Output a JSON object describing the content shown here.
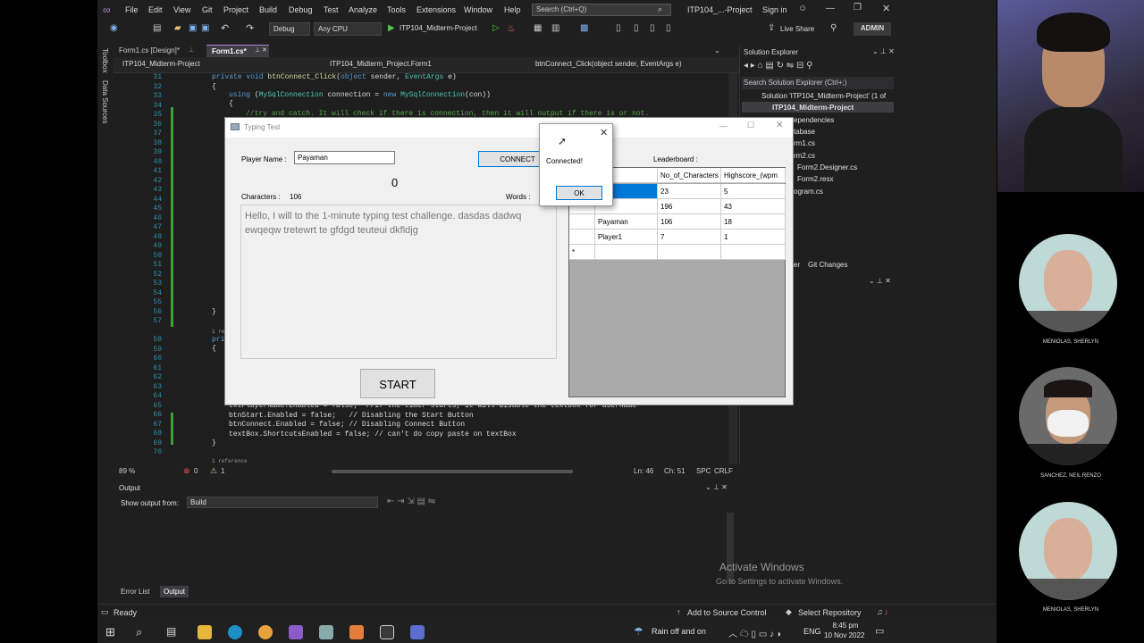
{
  "menubar": {
    "items": [
      "File",
      "Edit",
      "View",
      "Git",
      "Project",
      "Build",
      "Debug",
      "Test",
      "Analyze",
      "Tools",
      "Extensions",
      "Window",
      "Help"
    ],
    "search_placeholder": "Search (Ctrl+Q)",
    "solution_title": "ITP104_...-Project",
    "sign_in": "Sign in",
    "live_share": "Live Share",
    "admin_badge": "ADMIN"
  },
  "toolbar": {
    "config": "Debug",
    "platform": "Any CPU",
    "run_target": "ITP104_Midterm-Project"
  },
  "side_tabs": [
    "Toolbox",
    "Data Sources"
  ],
  "doc_tabs": [
    {
      "label": "Form1.cs [Design]*"
    },
    {
      "label": "Form1.cs*"
    }
  ],
  "navbar": {
    "project": "ITP104_Midterm-Project",
    "class": "ITP104_Midterm_Project.Form1",
    "member": "btnConnect_Click(object sender, EventArgs e)"
  },
  "editor": {
    "line_numbers": [
      "31",
      "32",
      "33",
      "34",
      "35",
      "36",
      "37",
      "38",
      "39",
      "40",
      "41",
      "42",
      "43",
      "44",
      "45",
      "46",
      "47",
      "48",
      "49",
      "50",
      "51",
      "52",
      "53",
      "54",
      "55",
      "56",
      "57",
      "",
      "58",
      "59",
      "60",
      "61",
      "62",
      "63",
      "64",
      "65",
      "66",
      "67",
      "68",
      "69",
      "70"
    ],
    "line_private": "private void btnConnect_Click(object sender, EventArgs e)",
    "line_open": "{",
    "line_using": "using (MySqlConnection connection = new MySqlConnection(con))",
    "line_open2": "{",
    "line_comment": "//try and catch. It will check if there is connection, then it will output if there is or not.",
    "line_close": "}",
    "line_ref": "1 reference",
    "line_pri": "pri",
    "line_open3": "{",
    "line_65": "txtPlayerName.Enabled = false;  //if the timer starts, it will disable the textbox for username",
    "line_66": "btnStart.Enabled = false;   // Disabling the Start Button",
    "line_67": "btnConnect.Enabled = false; // Disabling Connect Button",
    "line_68": "textBox.ShortcutsEnabled = false; // can't do copy paste on textBox",
    "line_69": "}",
    "line_ref2": "1 reference"
  },
  "editor_status": {
    "zoom": "89 %",
    "errors": "0",
    "warnings": "1",
    "line": "Ln: 46",
    "col": "Ch: 51",
    "spc": "SPC",
    "crlf": "CRLF"
  },
  "solution_explorer": {
    "title": "Solution Explorer",
    "search": "Search Solution Explorer (Ctrl+;)",
    "items": [
      "Solution 'ITP104_Midterm-Project' (1 of",
      "ITP104_Midterm-Project",
      "ependencies",
      "tabase",
      "rm1.cs",
      "rm2.cs",
      "Form2.Designer.cs",
      "Form2.resx",
      "ogram.cs"
    ],
    "bottom_tabs": [
      "er",
      "Git Changes"
    ]
  },
  "output": {
    "title": "Output",
    "show_from_label": "Show output from:",
    "show_from_value": "Build",
    "tabs": [
      "Error List",
      "Output"
    ]
  },
  "watermark": {
    "line1": "Activate Windows",
    "line2": "Go to Settings to activate Windows."
  },
  "statusbar": {
    "ready": "Ready",
    "source_control": "Add to Source Control",
    "repository": "Select Repository",
    "notifications": "2"
  },
  "taskbar": {
    "weather": "Rain off and on",
    "lang": "ENG",
    "time": "8:45 pm",
    "date": "10 Nov 2022"
  },
  "form": {
    "title": "Typing Test",
    "player_label": "Player Name :",
    "player_value": "Payaman",
    "connect_button": "CONNECT",
    "timer": "0",
    "chars_label": "Characters :",
    "chars_value": "106",
    "words_label": "Words :",
    "text": "Hello, I will to the 1-minute typing test challenge.  dasdas dadwq ewqeqw tretewrt te gfdgd teuteui dkfldjg",
    "start_button": "START",
    "leaderboard_label": "Leaderboard :",
    "grid_headers": [
      "me",
      "No_of_Characters",
      "Highscore_(wpm"
    ],
    "grid_rows": [
      [
        "",
        "23",
        "5"
      ],
      [
        "",
        "196",
        "43"
      ],
      [
        "Payaman",
        "106",
        "18"
      ],
      [
        "Player1",
        "7",
        "1"
      ]
    ],
    "new_row_marker": "*"
  },
  "msgbox": {
    "text": "Connected!",
    "ok": "OK"
  },
  "participants": [
    {
      "name": "MENIOLAS, SHERLYN"
    },
    {
      "name": "SANCHEZ, NEIL RENZO"
    },
    {
      "name": "MENIOLAS, SHERLYN"
    }
  ],
  "colors": {
    "vs_bg": "#1f1f1f",
    "editor_bg": "#1e1e1e",
    "accent": "#0078d7",
    "form_bg": "#f0f0f0"
  }
}
